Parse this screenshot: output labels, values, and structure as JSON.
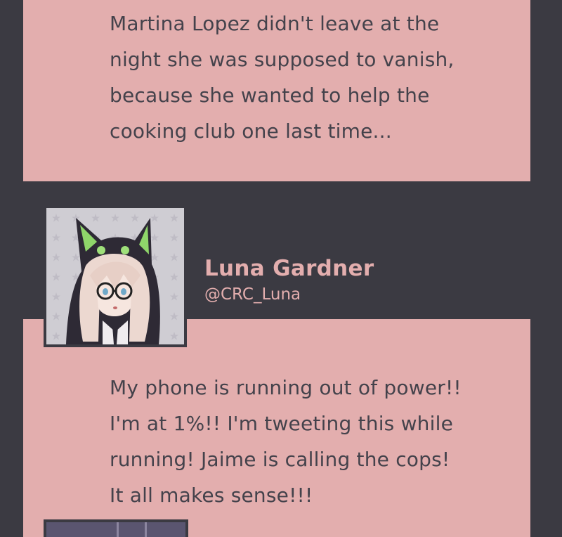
{
  "posts": [
    {
      "text_lines": [
        "Martina Lopez didn't leave at the",
        "night she was supposed to vanish,",
        "because she wanted to help the",
        "cooking club one last time..."
      ]
    },
    {
      "author": {
        "name": "Luna Gardner",
        "handle": "@CRC_Luna",
        "avatar_icon": "anime-girl-cat-hood-avatar"
      },
      "text_lines": [
        "My phone is running out of power!!",
        "I'm at 1%!! I'm tweeting this while",
        "running! Jaime is calling the cops!",
        "It all makes sense!!!"
      ]
    }
  ],
  "colors": {
    "background": "#3b3a42",
    "card": "#e3aeae",
    "text": "#44424b",
    "accent_name": "#e3aeae"
  }
}
